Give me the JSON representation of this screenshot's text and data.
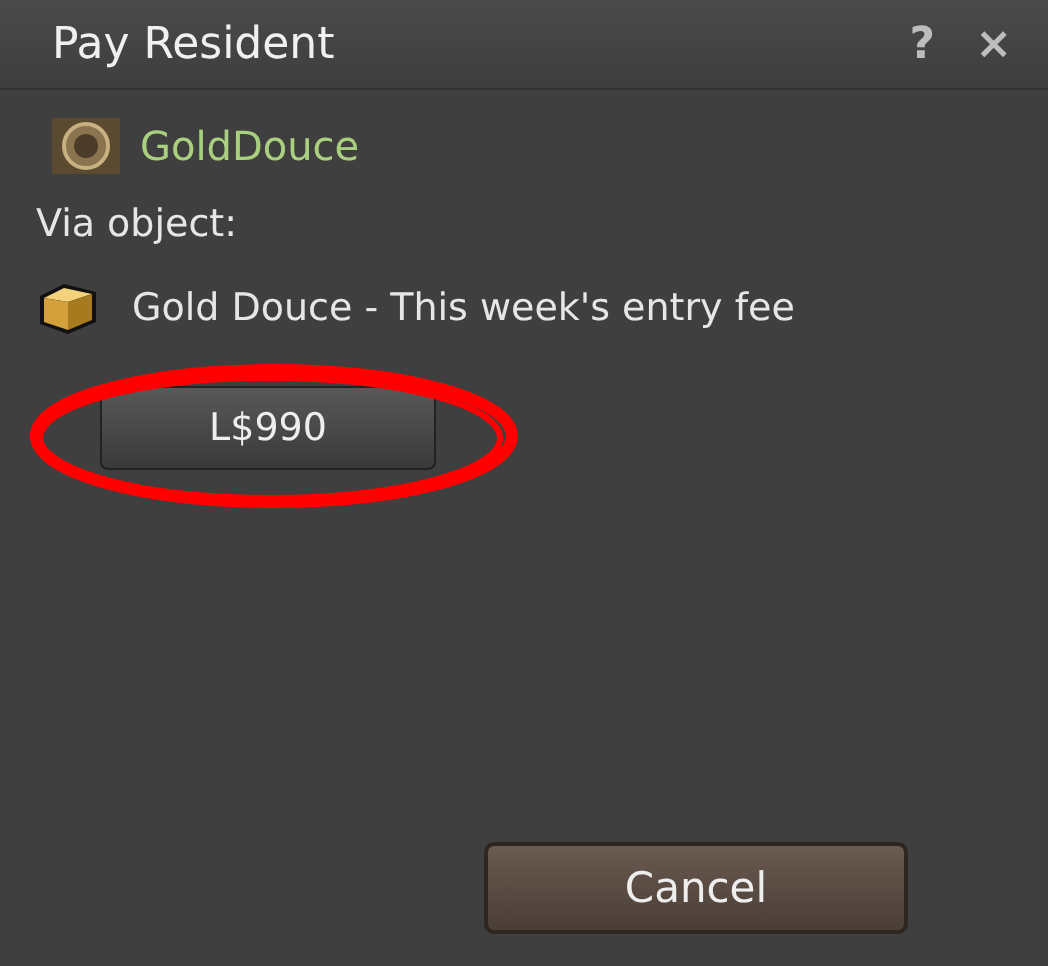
{
  "window": {
    "title": "Pay Resident",
    "help": "?",
    "close": "×"
  },
  "payee": {
    "name": "GoldDouce"
  },
  "via_label": "Via object:",
  "object": {
    "name": "Gold Douce - This week's entry fee"
  },
  "pay_buttons": [
    {
      "label": "L$990",
      "highlighted": true
    }
  ],
  "buttons": [
    "Cancel"
  ]
}
